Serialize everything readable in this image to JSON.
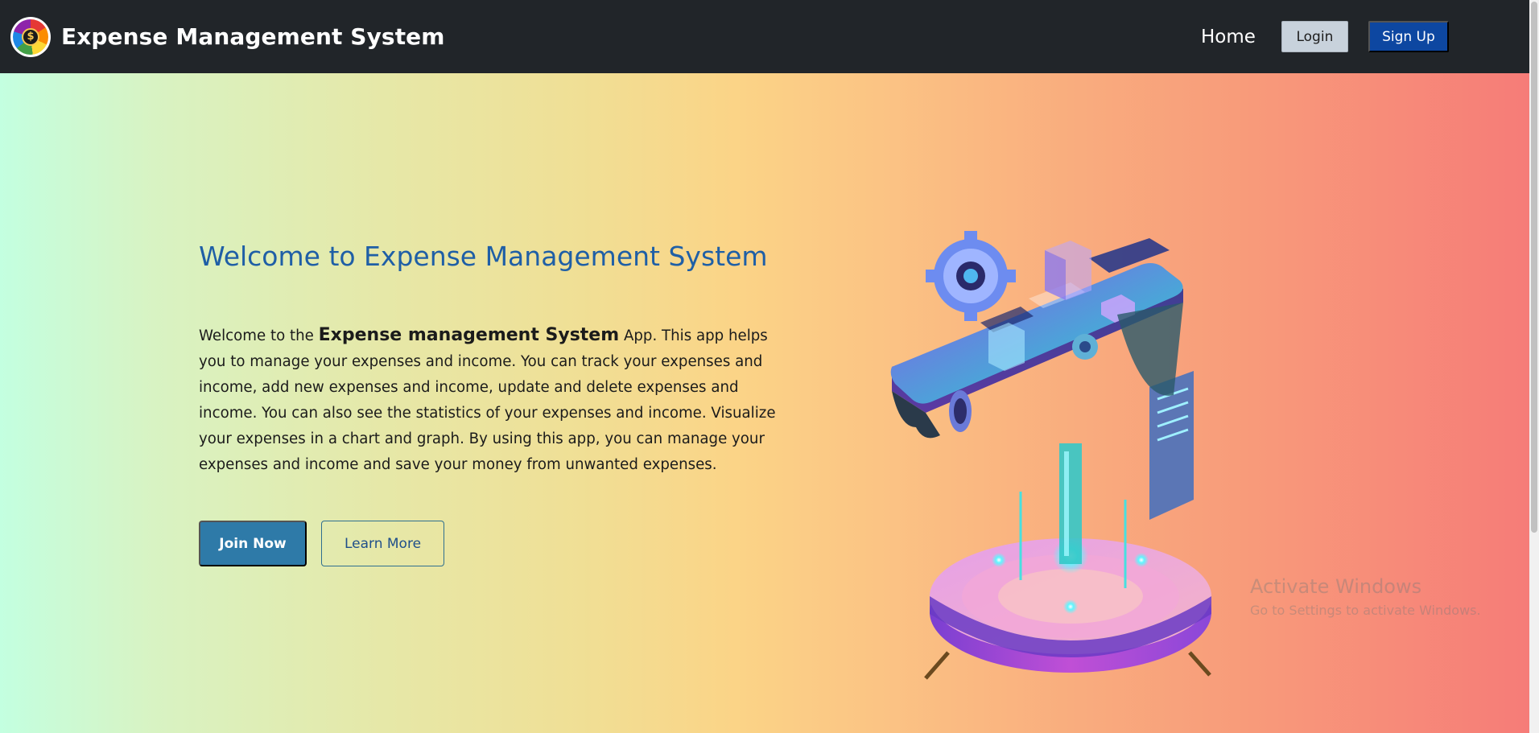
{
  "navbar": {
    "brand_title": "Expense Management System",
    "logo_symbol": "$",
    "home_label": "Home",
    "login_label": "Login",
    "signup_label": "Sign Up"
  },
  "hero": {
    "title": "Welcome to Expense Management System",
    "text_before": "Welcome to the ",
    "text_emph": "Expense management System",
    "text_after": " App. This app helps you to manage your expenses and income. You can track your expenses and income, add new expenses and income, update and delete expenses and income. You can also see the statistics of your expenses and income. Visualize your expenses in a chart and graph. By using this app, you can manage your expenses and income and save your money from unwanted expenses.",
    "join_label": "Join Now",
    "learn_label": "Learn More",
    "illustration_icon": "isometric-phone-illustration"
  },
  "watermark": {
    "title": "Activate Windows",
    "subtitle": "Go to Settings to activate Windows."
  },
  "colors": {
    "navbar_bg": "#212529",
    "title_blue": "#1f5fa6",
    "join_button": "#2e7aa8",
    "signup_button": "#0d47a1",
    "gradient_start": "#c3ffe0",
    "gradient_mid": "#fbd487",
    "gradient_end": "#f67c78"
  }
}
